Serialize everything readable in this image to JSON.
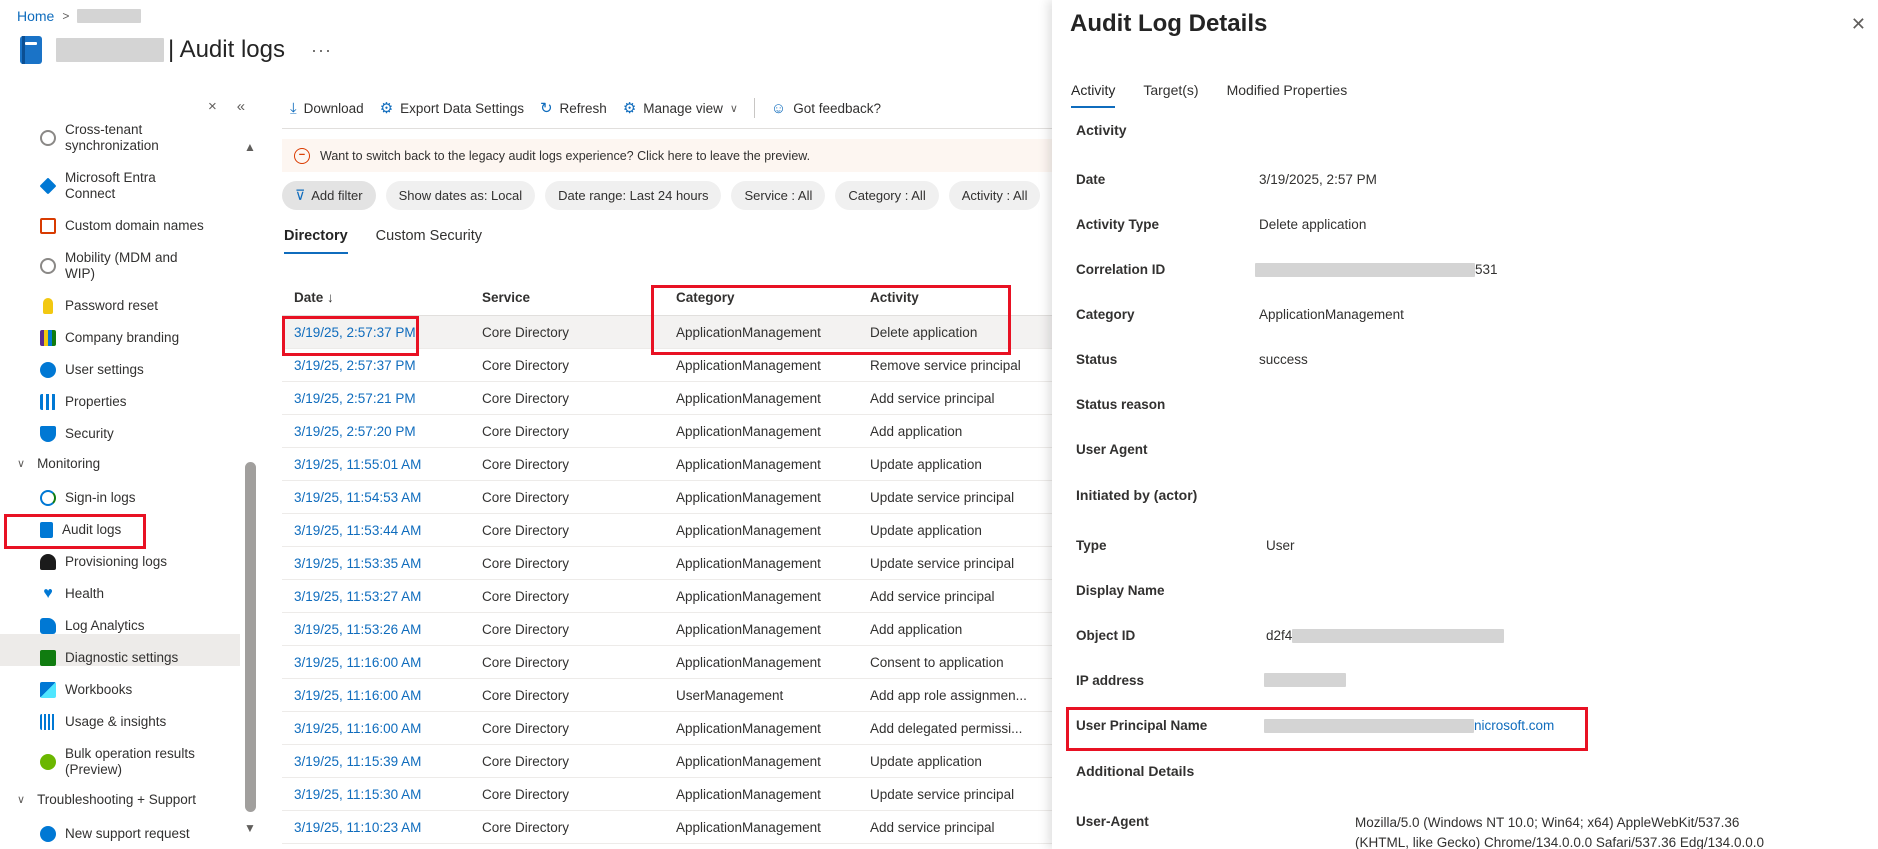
{
  "breadcrumb": {
    "home": "Home",
    "sep": ">"
  },
  "header": {
    "title": "| Audit logs",
    "more": "···"
  },
  "sidebar_controls": {
    "close": "×",
    "collapse": "«"
  },
  "sidebar": {
    "items": [
      {
        "label": "Cross-tenant synchronization",
        "icon": "cross-tenant-sync-icon",
        "color": "#8a8886"
      },
      {
        "label": "Microsoft Entra Connect",
        "icon": "entra-connect-icon",
        "color": "#0078d4"
      },
      {
        "label": "Custom domain names",
        "icon": "domain-icon",
        "color": "#d83b01"
      },
      {
        "label": "Mobility (MDM and WIP)",
        "icon": "mobility-icon",
        "color": "#8a8886"
      },
      {
        "label": "Password reset",
        "icon": "key-icon",
        "color": "#f2c811"
      },
      {
        "label": "Company branding",
        "icon": "branding-icon",
        "color": "#5c2e91"
      },
      {
        "label": "User settings",
        "icon": "user-settings-icon",
        "color": "#0078d4"
      },
      {
        "label": "Properties",
        "icon": "properties-icon",
        "color": "#0078d4"
      },
      {
        "label": "Security",
        "icon": "shield-icon",
        "color": "#0078d4"
      }
    ],
    "group_monitoring": "Monitoring",
    "monitoring_items": [
      {
        "label": "Sign-in logs",
        "icon": "sign-in-icon",
        "color": "#107c10"
      },
      {
        "label": "Audit logs",
        "icon": "audit-log-icon",
        "color": "#0078d4"
      },
      {
        "label": "Provisioning logs",
        "icon": "provisioning-icon",
        "color": "#000000"
      },
      {
        "label": "Health",
        "icon": "health-icon",
        "color": "#0078d4"
      },
      {
        "label": "Log Analytics",
        "icon": "log-analytics-icon",
        "color": "#0078d4"
      },
      {
        "label": "Diagnostic settings",
        "icon": "diagnostic-icon",
        "color": "#107c10"
      },
      {
        "label": "Workbooks",
        "icon": "workbooks-icon",
        "color": "#0078d4"
      },
      {
        "label": "Usage & insights",
        "icon": "usage-icon",
        "color": "#0078d4"
      },
      {
        "label": "Bulk operation results (Preview)",
        "icon": "bulk-ops-icon",
        "color": "#6bb700"
      }
    ],
    "group_troubleshooting": "Troubleshooting + Support",
    "support_item": {
      "label": "New support request",
      "icon": "support-icon",
      "color": "#0078d4"
    }
  },
  "toolbar": {
    "download": "Download",
    "export": "Export Data Settings",
    "refresh": "Refresh",
    "manage_view": "Manage view",
    "feedback": "Got feedback?"
  },
  "banner": "Want to switch back to the legacy audit logs experience? Click here to leave the preview.",
  "filters": {
    "add": "Add filter",
    "dates": "Show dates as: Local",
    "range": "Date range: Last 24 hours",
    "service": "Service : All",
    "category": "Category : All",
    "activity": "Activity : All"
  },
  "tabs": {
    "directory": "Directory",
    "custom_security": "Custom Security"
  },
  "table": {
    "headers": [
      "Date ↓",
      "Service",
      "Category",
      "Activity"
    ],
    "rows": [
      [
        "3/19/25, 2:57:37 PM",
        "Core Directory",
        "ApplicationManagement",
        "Delete application"
      ],
      [
        "3/19/25, 2:57:37 PM",
        "Core Directory",
        "ApplicationManagement",
        "Remove service principal"
      ],
      [
        "3/19/25, 2:57:21 PM",
        "Core Directory",
        "ApplicationManagement",
        "Add service principal"
      ],
      [
        "3/19/25, 2:57:20 PM",
        "Core Directory",
        "ApplicationManagement",
        "Add application"
      ],
      [
        "3/19/25, 11:55:01 AM",
        "Core Directory",
        "ApplicationManagement",
        "Update application"
      ],
      [
        "3/19/25, 11:54:53 AM",
        "Core Directory",
        "ApplicationManagement",
        "Update service principal"
      ],
      [
        "3/19/25, 11:53:44 AM",
        "Core Directory",
        "ApplicationManagement",
        "Update application"
      ],
      [
        "3/19/25, 11:53:35 AM",
        "Core Directory",
        "ApplicationManagement",
        "Update service principal"
      ],
      [
        "3/19/25, 11:53:27 AM",
        "Core Directory",
        "ApplicationManagement",
        "Add service principal"
      ],
      [
        "3/19/25, 11:53:26 AM",
        "Core Directory",
        "ApplicationManagement",
        "Add application"
      ],
      [
        "3/19/25, 11:16:00 AM",
        "Core Directory",
        "ApplicationManagement",
        "Consent to application"
      ],
      [
        "3/19/25, 11:16:00 AM",
        "Core Directory",
        "UserManagement",
        "Add app role assignmen..."
      ],
      [
        "3/19/25, 11:16:00 AM",
        "Core Directory",
        "ApplicationManagement",
        "Add delegated permissi..."
      ],
      [
        "3/19/25, 11:15:39 AM",
        "Core Directory",
        "ApplicationManagement",
        "Update application"
      ],
      [
        "3/19/25, 11:15:30 AM",
        "Core Directory",
        "ApplicationManagement",
        "Update service principal"
      ],
      [
        "3/19/25, 11:10:23 AM",
        "Core Directory",
        "ApplicationManagement",
        "Add service principal"
      ]
    ]
  },
  "details": {
    "title": "Audit Log Details",
    "close": "✕",
    "tabs": [
      "Activity",
      "Target(s)",
      "Modified Properties"
    ],
    "section_activity": "Activity",
    "date_label": "Date",
    "date": "3/19/2025, 2:57 PM",
    "activity_type_label": "Activity Type",
    "activity_type": "Delete application",
    "correlation_label": "Correlation ID",
    "correlation_suffix": "531",
    "category_label": "Category",
    "category": "ApplicationManagement",
    "status_label": "Status",
    "status": "success",
    "status_reason_label": "Status reason",
    "user_agent_label": "User Agent",
    "section_initiated": "Initiated by (actor)",
    "type_label": "Type",
    "type": "User",
    "display_name_label": "Display Name",
    "object_id_label": "Object ID",
    "object_id_prefix": "d2f4",
    "ip_label": "IP address",
    "upn_label": "User Principal Name",
    "upn_suffix": "nicrosoft.com",
    "section_additional": "Additional Details",
    "ua_label": "User-Agent",
    "ua_line1": "Mozilla/5.0 (Windows NT 10.0; Win64; x64) AppleWebKit/537.36",
    "ua_line2": "(KHTML, like Gecko) Chrome/134.0.0.0 Safari/537.36 Edg/134.0.0.0"
  }
}
